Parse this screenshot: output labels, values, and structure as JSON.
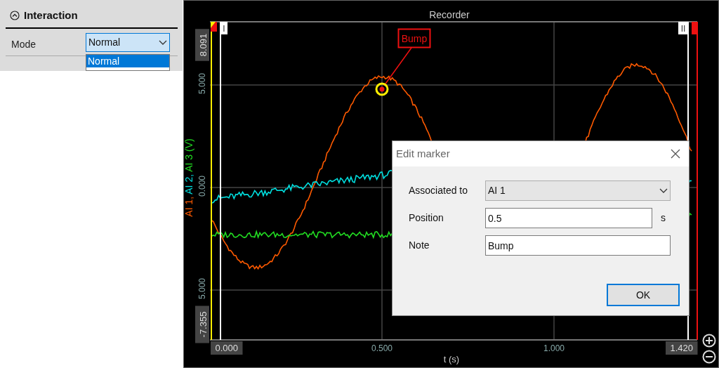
{
  "properties_panel": {
    "section": {
      "title": "Interaction",
      "expanded": true
    },
    "mode": {
      "label": "Mode",
      "value": "Normal",
      "dropdown_open": true,
      "options": [
        {
          "label": "Normal",
          "selected": true
        },
        {
          "selected": false
        }
      ]
    }
  },
  "recorder": {
    "title": "Recorder",
    "y_axis": {
      "title_parts": [
        {
          "text": "AI 1,",
          "color": "#ff5a00"
        },
        {
          "text": "AI 2,",
          "color": "#00e0e0"
        },
        {
          "text": "AI 3 (V)",
          "color": "#22dd22"
        }
      ],
      "max_label": "8.091",
      "min_label": "-7.355",
      "tick_labels": [
        "5.000",
        "0.000",
        "5.000"
      ]
    },
    "x_axis": {
      "title": "t (s)",
      "min_label": "0.000",
      "max_label": "1.420",
      "tick_labels": [
        "0.500",
        "1.000"
      ]
    },
    "cursors": [
      {
        "label": "I",
        "kind": "start"
      },
      {
        "label": "II",
        "kind": "end"
      }
    ],
    "marker": {
      "label": "Bump"
    }
  },
  "dialog": {
    "title": "Edit marker",
    "fields": [
      {
        "kind": "select",
        "label": "Associated to",
        "value": "AI 1"
      },
      {
        "kind": "input",
        "label": "Position",
        "value": "0.5",
        "unit": "s"
      },
      {
        "kind": "input",
        "label": "Note",
        "value": "Bump"
      }
    ],
    "ok_button": "OK"
  }
}
